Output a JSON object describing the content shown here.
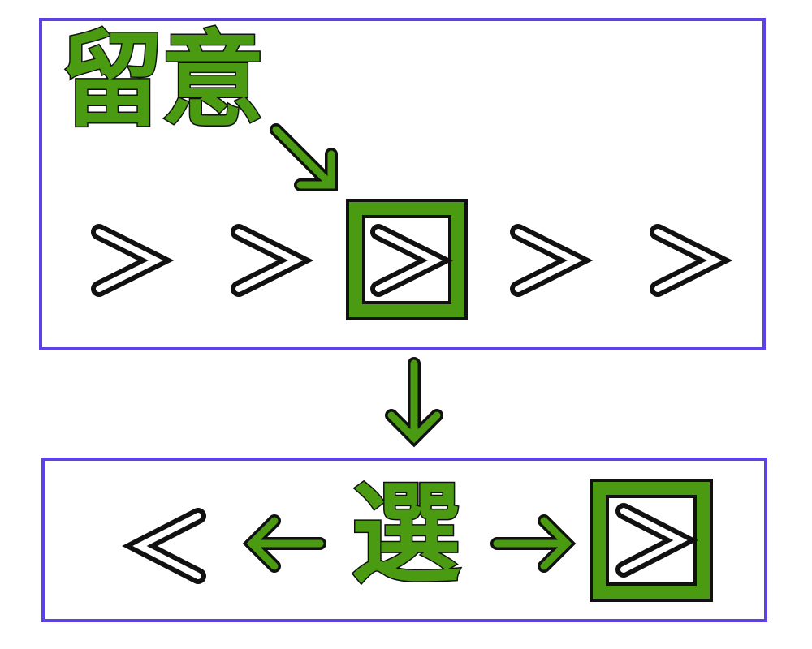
{
  "top_panel": {
    "label": "留意",
    "sequence": [
      {
        "symbol": ">",
        "highlighted": false
      },
      {
        "symbol": ">",
        "highlighted": false
      },
      {
        "symbol": ">",
        "highlighted": true
      },
      {
        "symbol": ">",
        "highlighted": false
      },
      {
        "symbol": ">",
        "highlighted": false
      }
    ]
  },
  "bottom_panel": {
    "label": "選",
    "left_symbol": "<",
    "right_symbol": ">",
    "right_highlighted": true
  },
  "colors": {
    "panel_border": "#5b43e6",
    "accent_green": "#4a9a12",
    "outline": "#111111",
    "glyph_fill": "#ffffff"
  },
  "icons": [
    "arrow-down-right-icon",
    "arrow-down-icon",
    "arrow-left-icon",
    "arrow-right-icon",
    "chevron-right-icon",
    "chevron-left-icon"
  ]
}
